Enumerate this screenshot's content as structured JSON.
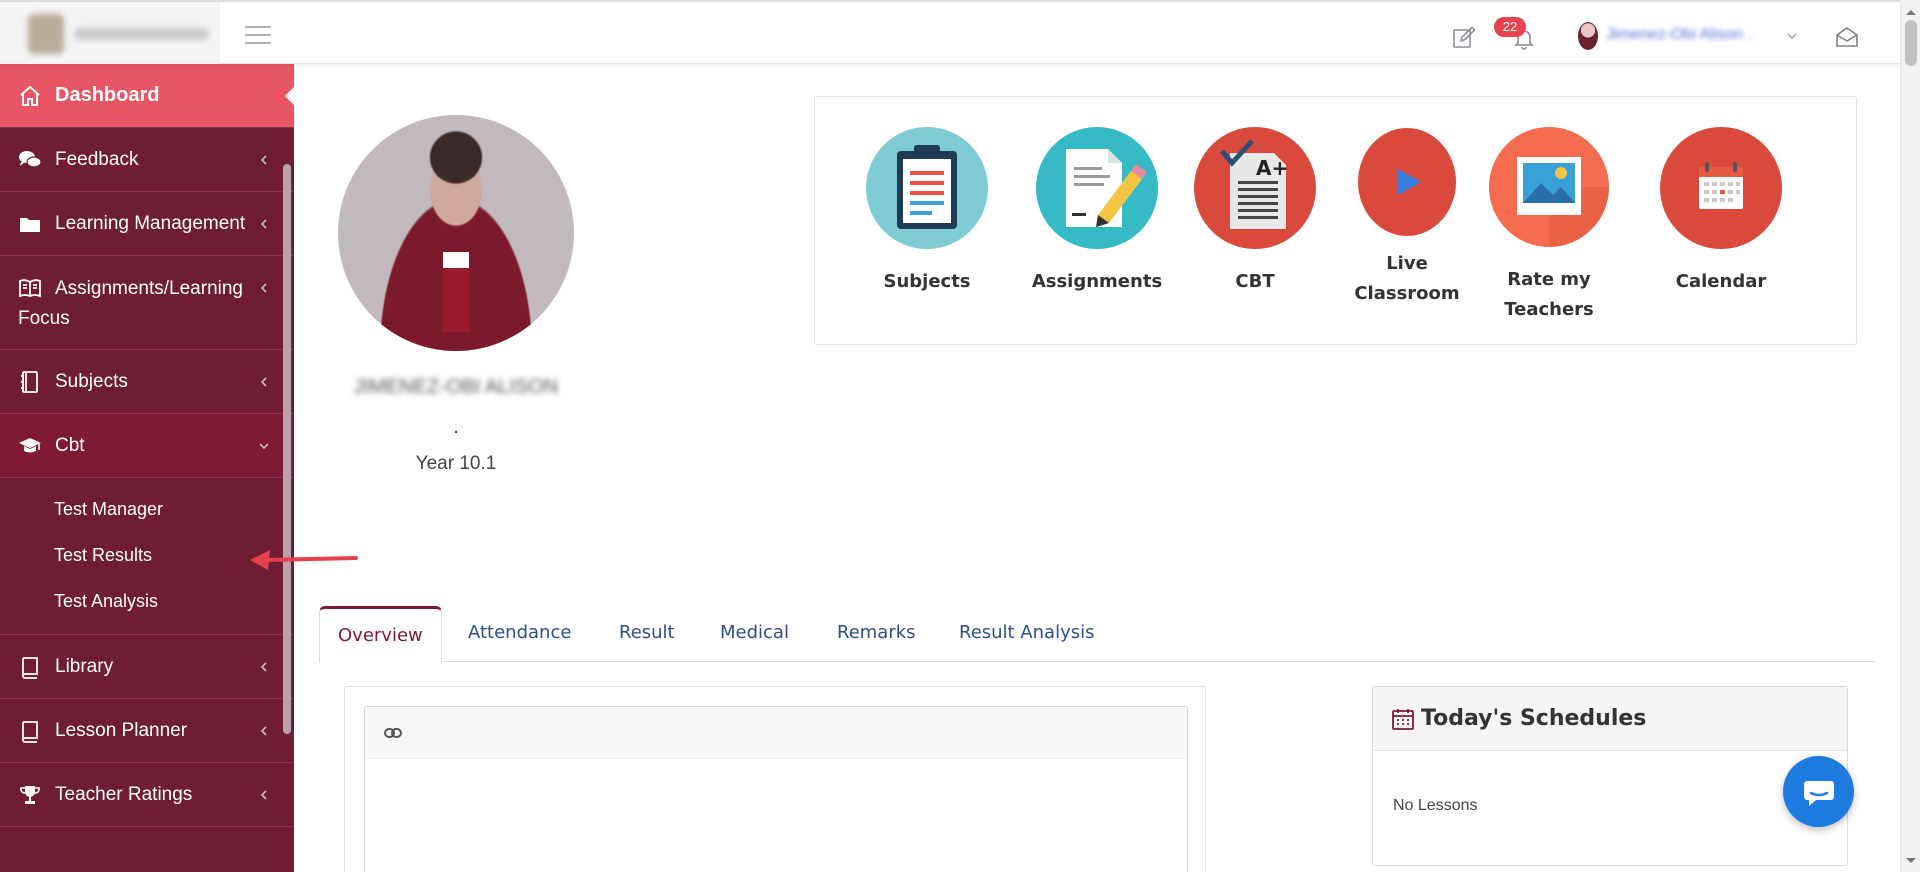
{
  "topbar": {
    "notification_count": "22",
    "user_name": "Jimenez-Obi Alison ."
  },
  "sidebar": {
    "items": [
      {
        "label": "Dashboard",
        "icon": "home-icon"
      },
      {
        "label": "Feedback",
        "icon": "comments-icon"
      },
      {
        "label": "Learning Management",
        "icon": "folder-icon"
      },
      {
        "label": "Assignments/Learning Focus",
        "icon": "book-open-icon"
      },
      {
        "label": "Subjects",
        "icon": "notebook-icon"
      },
      {
        "label": "Cbt",
        "icon": "graduation-cap-icon"
      },
      {
        "label": "Library",
        "icon": "book-icon"
      },
      {
        "label": "Lesson Planner",
        "icon": "book-icon"
      },
      {
        "label": "Teacher Ratings",
        "icon": "trophy-icon"
      }
    ],
    "cbt_submenu": [
      "Test Manager",
      "Test Results",
      "Test Analysis"
    ]
  },
  "student": {
    "name": "JIMENEZ-OBI ALISON",
    "dot": ".",
    "class": "Year 10.1"
  },
  "shortcuts": [
    {
      "label": "Subjects",
      "icon": "clipboard-icon",
      "color": "#7fcbd4"
    },
    {
      "label": "Assignments",
      "icon": "document-pencil-icon",
      "color": "#35bac6"
    },
    {
      "label": "CBT",
      "icon": "test-grade-icon",
      "color": "#d94a3c"
    },
    {
      "label": "Live Classroom",
      "icon": "play-icon",
      "color": "#d94a3c"
    },
    {
      "label": "Rate my",
      "label2": "Teachers",
      "icon": "picture-icon",
      "color": "#f46b50"
    },
    {
      "label": "Calendar",
      "icon": "calendar-icon",
      "color": "#d94a3c"
    }
  ],
  "tabs": [
    "Overview",
    "Attendance",
    "Result",
    "Medical",
    "Remarks",
    "Result Analysis"
  ],
  "schedules": {
    "title": "Today's Schedules",
    "empty_text": "No Lessons"
  },
  "colors": {
    "sidebar_bg": "#6e1d33",
    "sidebar_active": "#e85565",
    "tab_active": "#7e1a34",
    "link": "#2c4f8c",
    "chat": "#1e7be0",
    "badge": "#e8414f"
  }
}
